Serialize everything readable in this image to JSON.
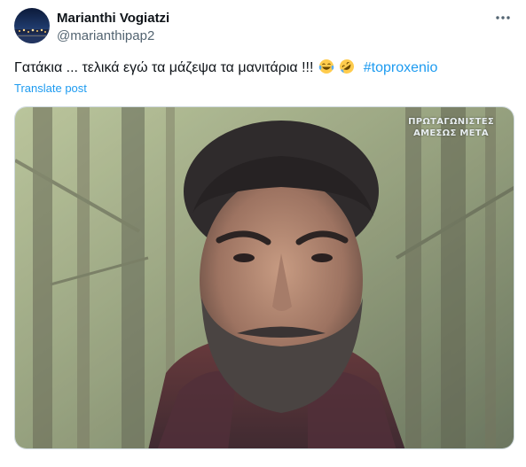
{
  "author": {
    "display_name": "Marianthi Vogiatzi",
    "handle": "@marianthipap2",
    "avatar_icon": "avatar-photo"
  },
  "more_icon": "more-horizontal-icon",
  "post": {
    "text": "Γατάκια ... τελικά εγώ τα μάζεψα τα μανιτάρια !!!",
    "emojis": [
      "face-with-tears-of-joy-emoji",
      "rolling-on-floor-laughing-emoji"
    ],
    "hashtag": "#toproxenio",
    "translate_label": "Translate post"
  },
  "media": {
    "overlay_line1": "ΠΡΩΤΑΓΩΝΙΣΤΕΣ",
    "overlay_line2": "ΑΜΕΣΩΣ ΜΕΤΑ"
  },
  "colors": {
    "link": "#1d9bf0",
    "secondary_text": "#536471",
    "primary_text": "#0f1419",
    "border": "#cfd9de"
  }
}
